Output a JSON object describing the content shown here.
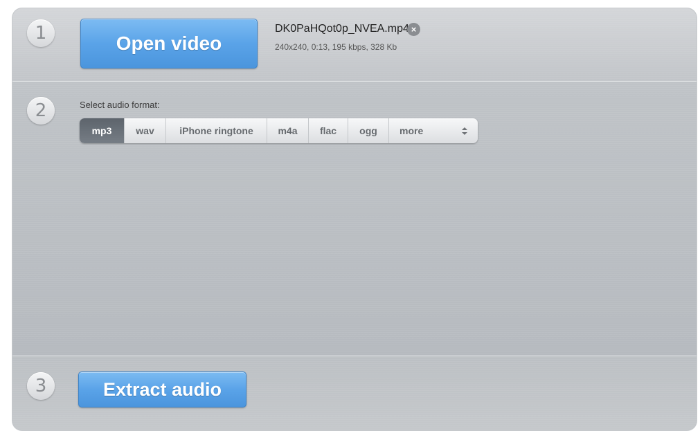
{
  "steps": {
    "one": "1",
    "two": "2",
    "three": "3"
  },
  "open_button": {
    "label": "Open video"
  },
  "file": {
    "name": "DK0PaHQot0p_NVEA.mp4",
    "close_icon": "×",
    "meta": "240x240, 0:13, 195 kbps, 328 Kb"
  },
  "format": {
    "label": "Select audio format:",
    "options": [
      "mp3",
      "wav",
      "iPhone ringtone",
      "m4a",
      "flac",
      "ogg"
    ],
    "selected": "mp3",
    "more_label": "more",
    "more_icon": "up-down-chevron-icon"
  },
  "extract_button": {
    "label": "Extract audio"
  },
  "colors": {
    "accent_blue": "#5aa3e8",
    "selected_dark": "#5d646c"
  }
}
